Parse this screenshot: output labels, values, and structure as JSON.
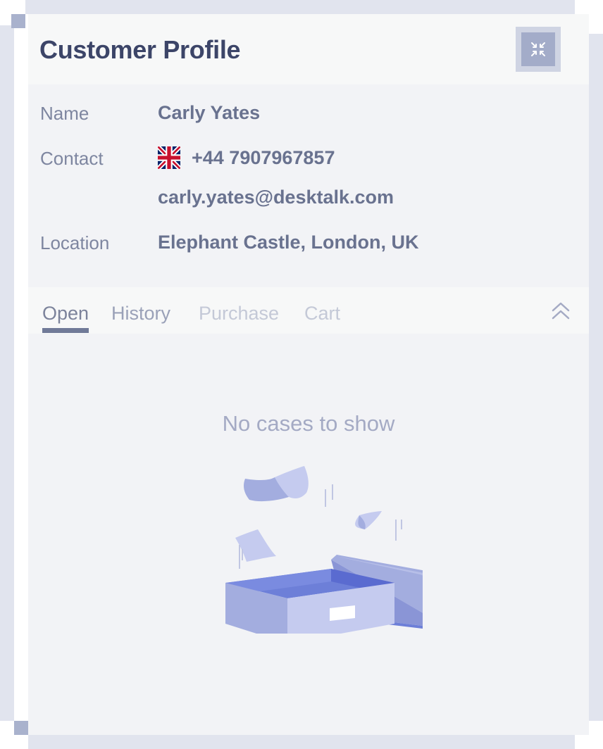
{
  "header": {
    "title": "Customer Profile",
    "collapse_icon": "collapse-arrows-icon"
  },
  "profile": {
    "name_label": "Name",
    "name_value": "Carly Yates",
    "contact_label": "Contact",
    "phone_flag": "uk-flag-icon",
    "phone": "+44 7907967857",
    "email": "carly.yates@desktalk.com",
    "location_label": "Location",
    "location_value": "Elephant Castle, London, UK"
  },
  "tabs": [
    {
      "label": "Open",
      "active": true
    },
    {
      "label": "History",
      "active": false
    },
    {
      "label": "Purchase",
      "active": false
    },
    {
      "label": "Cart",
      "active": false
    }
  ],
  "tabs_toggle_icon": "double-chevron-up-icon",
  "empty_state": {
    "message": "No cases to show",
    "illustration": "open-box-illustration"
  },
  "colors": {
    "title": "#3c4568",
    "accent": "#707a98",
    "illustration_light": "#c5cbef",
    "illustration_dark": "#6d7fd8"
  }
}
